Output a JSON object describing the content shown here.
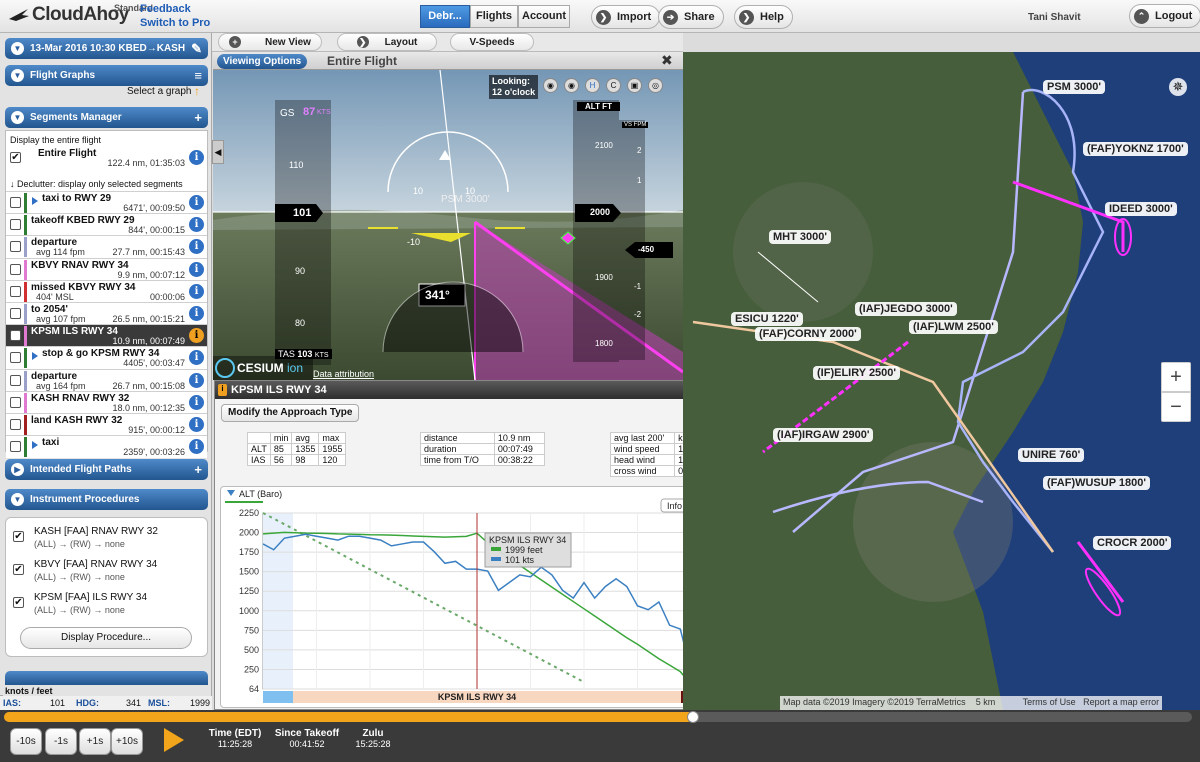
{
  "app": {
    "name": "CloudAhoy",
    "edition": "Standard",
    "feedback": "Feedback",
    "switch_pro": "Switch to Pro"
  },
  "tabs": [
    {
      "label": "Debr..."
    },
    {
      "label": "Flights"
    },
    {
      "label": "Account"
    }
  ],
  "header_buttons": {
    "import": "Import",
    "share": "Share",
    "help": "Help",
    "logout": "Logout"
  },
  "user": "Tani Shavit",
  "subbar": {
    "new_view": "New View",
    "layout": "Layout",
    "vspeeds": "V-Speeds"
  },
  "flight_header": "13-Mar 2016 10:30  KBED→KASH",
  "flight_graphs": {
    "title": "Flight Graphs",
    "select": "Select a graph"
  },
  "segments": {
    "title": "Segments Manager",
    "display_entire": "Display the entire flight",
    "entire": {
      "name": "Entire Flight",
      "stats": "122.4 nm, 01:35:03"
    },
    "declutter": "Declutter: display only selected segments",
    "items": [
      {
        "name": "taxi to RWY 29",
        "stats": "6471', 00:09:50",
        "color": "#2e7d32"
      },
      {
        "name": "takeoff KBED RWY 29",
        "stats": "844', 00:00:15",
        "color": "#2e7d32"
      },
      {
        "name": "departure",
        "sub": "avg 114 fpm",
        "stats": "27.7 nm, 00:15:43",
        "color": "#9aa0c8"
      },
      {
        "name": "KBVY RNAV RWY 34",
        "stats": "9.9 nm, 00:07:12",
        "color": "#e07ad0"
      },
      {
        "name": "missed KBVY RWY 34",
        "sub": "404' MSL",
        "stats": "00:00:06",
        "color": "#d03030"
      },
      {
        "name": "to 2054'",
        "sub": "avg 107 fpm",
        "stats": "26.5 nm, 00:15:21",
        "color": "#9aa0c8"
      },
      {
        "name": "KPSM ILS RWY 34",
        "stats": "10.9 nm, 00:07:49",
        "color": "#e07ad0"
      },
      {
        "name": "stop & go KPSM RWY 34",
        "stats": "4405', 00:03:47",
        "color": "#2e7d32"
      },
      {
        "name": "departure",
        "sub": "avg 164 fpm",
        "stats": "26.7 nm, 00:15:08",
        "color": "#9aa0c8"
      },
      {
        "name": "KASH RNAV RWY 32",
        "stats": "18.0 nm, 00:12:35",
        "color": "#e07ad0"
      },
      {
        "name": "land KASH RWY 32",
        "stats": "915', 00:00:12",
        "color": "#a02020"
      },
      {
        "name": "taxi",
        "stats": "2359', 00:03:26",
        "color": "#2e7d32"
      }
    ]
  },
  "intended": "Intended Flight Paths",
  "procedures": {
    "title": "Instrument Procedures",
    "items": [
      {
        "name": "KASH [FAA] RNAV RWY 32",
        "sub": "(ALL) → (RW) → none"
      },
      {
        "name": "KBVY [FAA] RNAV RWY 34",
        "sub": "(ALL) → (RW) → none"
      },
      {
        "name": "KPSM [FAA] ILS RWY 34",
        "sub": "(ALL) → (RW) → none"
      }
    ],
    "display_btn": "Display Procedure..."
  },
  "viewer": {
    "options": "Viewing Options",
    "title": "Entire Flight",
    "looking": "Looking:",
    "looking_val": "12 o'clock",
    "gs_label": "GS",
    "gs_val": "87",
    "gs_unit": "KTS",
    "speed": "101",
    "tas_label": "TAS",
    "tas_val": "103",
    "tas_unit": "KTS",
    "alt_label": "ALT FT",
    "vs_label": "VS FPM",
    "alt": "2000",
    "vs": "-450",
    "heading": "341°",
    "ground_label": "PSM 3000'",
    "speed_ticks": [
      "110",
      "100",
      "90",
      "80"
    ],
    "alt_ticks": [
      "2100",
      "1900",
      "1800"
    ],
    "vs_ticks": [
      "2",
      "1",
      "-1",
      "-2"
    ],
    "pitch_ticks": [
      "10",
      "10",
      "-10"
    ],
    "cesium": "CESIUM",
    "ion": "ion",
    "attribution": "Data attribution"
  },
  "popup": {
    "title": "KPSM ILS RWY 34",
    "modify": "Modify the Approach Type",
    "t1": {
      "head": [
        "",
        "min",
        "avg",
        "max"
      ],
      "rows": [
        [
          "ALT",
          "85",
          "1355",
          "1955"
        ],
        [
          "IAS",
          "56",
          "98",
          "120"
        ]
      ]
    },
    "t2": [
      [
        "distance",
        "10.9 nm"
      ],
      [
        "duration",
        "00:07:49"
      ],
      [
        "time from T/O",
        "00:38:22"
      ]
    ],
    "t3": [
      [
        "avg last 200'",
        "knots"
      ],
      [
        "wind speed",
        "12.6"
      ],
      [
        "head wind",
        "12.6"
      ],
      [
        "cross wind",
        "0.7"
      ]
    ],
    "graph_left": "ALT (Baro)",
    "graph_right": "IAS",
    "info": "Info",
    "tooltip": {
      "title": "KPSM ILS RWY 34",
      "alt": "1999 feet",
      "ias": "101 kts"
    },
    "footer": "KPSM ILS RWY 34",
    "colors": {
      "alt": "#3aa63a",
      "ias": "#3b80c2"
    }
  },
  "chart_data": {
    "type": "line",
    "title": "KPSM ILS RWY 34",
    "xlabel": "",
    "ylabel": "ALT (Baro)",
    "y2label": "IAS",
    "ylim": [
      64,
      2250
    ],
    "y2lim": [
      39,
      130
    ],
    "ytick_labels": [
      "2250",
      "2000",
      "1750",
      "1500",
      "1250",
      "1000",
      "750",
      "500",
      "250",
      "64"
    ],
    "y2tick_labels": [
      "130",
      "120",
      "110",
      "100",
      "90",
      "80",
      "70",
      "60",
      "50",
      "39"
    ],
    "x": [
      0,
      1,
      2,
      3,
      4,
      5,
      6,
      7,
      8,
      9,
      10,
      11,
      12,
      13,
      14,
      15,
      16,
      17,
      18,
      19,
      20,
      21,
      22,
      23,
      24,
      25,
      26,
      27,
      28,
      29,
      30,
      31,
      32,
      33,
      34,
      35,
      36,
      37,
      38,
      39,
      40
    ],
    "series": [
      {
        "name": "ALT (Baro)",
        "axis": "left",
        "values": [
          1990,
          2000,
          2010,
          2005,
          2000,
          1998,
          1995,
          1990,
          1988,
          1985,
          1980,
          1978,
          1975,
          1970,
          1965,
          1960,
          1955,
          1950,
          1955,
          1960,
          1999,
          1880,
          1780,
          1690,
          1600,
          1510,
          1420,
          1330,
          1240,
          1150,
          1060,
          970,
          880,
          790,
          700,
          620,
          530,
          440,
          360,
          280,
          120
        ]
      },
      {
        "name": "IAS",
        "axis": "right",
        "values": [
          114,
          111,
          117,
          118,
          119,
          118,
          117,
          116,
          118,
          118,
          117,
          116,
          113,
          114,
          115,
          115,
          110,
          104,
          105,
          101,
          101,
          100,
          90,
          94,
          98,
          97,
          102,
          98,
          90,
          86,
          94,
          86,
          92,
          96,
          92,
          82,
          80,
          84,
          72,
          70,
          48
        ]
      }
    ],
    "guide_line": {
      "name": "glideslope",
      "values": [
        2250,
        2180,
        2110,
        2040,
        1970,
        1900,
        1830,
        1760,
        1690,
        1620,
        1550,
        1480,
        1410,
        1340,
        1270,
        1200,
        1130,
        1060,
        990,
        920,
        850,
        780,
        710,
        640,
        570,
        500,
        430,
        360,
        290,
        220,
        150
      ]
    }
  },
  "map": {
    "labels": [
      "PSM 3000'",
      "(FAF)YOKNZ 1700'",
      "IDEED 3000'",
      "MHT 3000'",
      "ESICU 1220'",
      "(IAF)JEGDO 3000'",
      "(FAF)CORNY 2000'",
      "(IAF)LWM 2500'",
      "(IF)ELIRY 2500'",
      "(IAF)IRGAW 2900'",
      "UNIRE 760'",
      "(FAF)WUSUP 1800'",
      "CROCR 2000'"
    ],
    "zoom_in": "+",
    "zoom_out": "−",
    "footer": [
      "Map data ©2019 Imagery ©2019 TerraMetrics",
      "5 km",
      "Terms of Use",
      "Report a map error"
    ]
  },
  "status": {
    "units": "knots / feet",
    "ias_label": "IAS:",
    "ias": "101",
    "hdg_label": "HDG:",
    "hdg": "341",
    "msl_label": "MSL:",
    "msl": "1999"
  },
  "timeline": {
    "progress": 0.58,
    "buttons": [
      "-10s",
      "-1s",
      "+1s",
      "+10s"
    ],
    "time_label": "Time (EDT)",
    "time": "11:25:28",
    "since_label": "Since Takeoff",
    "since": "00:41:52",
    "zulu_label": "Zulu",
    "zulu": "15:25:28"
  }
}
